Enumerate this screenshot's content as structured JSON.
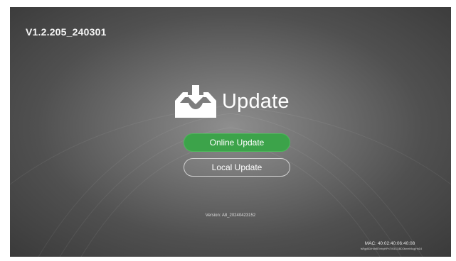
{
  "header": {
    "firmware_version": "V1.2.205_240301"
  },
  "hero": {
    "icon": "download-tray-icon",
    "title": "Update"
  },
  "buttons": {
    "online": {
      "label": "Online Update",
      "color": "#3ca34a"
    },
    "local": {
      "label": "Local Update"
    }
  },
  "footer": {
    "version": "Version: A8_20240423152",
    "mac": "MAC: 40:02:40:06:40:08",
    "serial": "fsRgpBDrHdeBTrebpHPnTVt3GQBDOkmeb9ugjHnD4"
  }
}
